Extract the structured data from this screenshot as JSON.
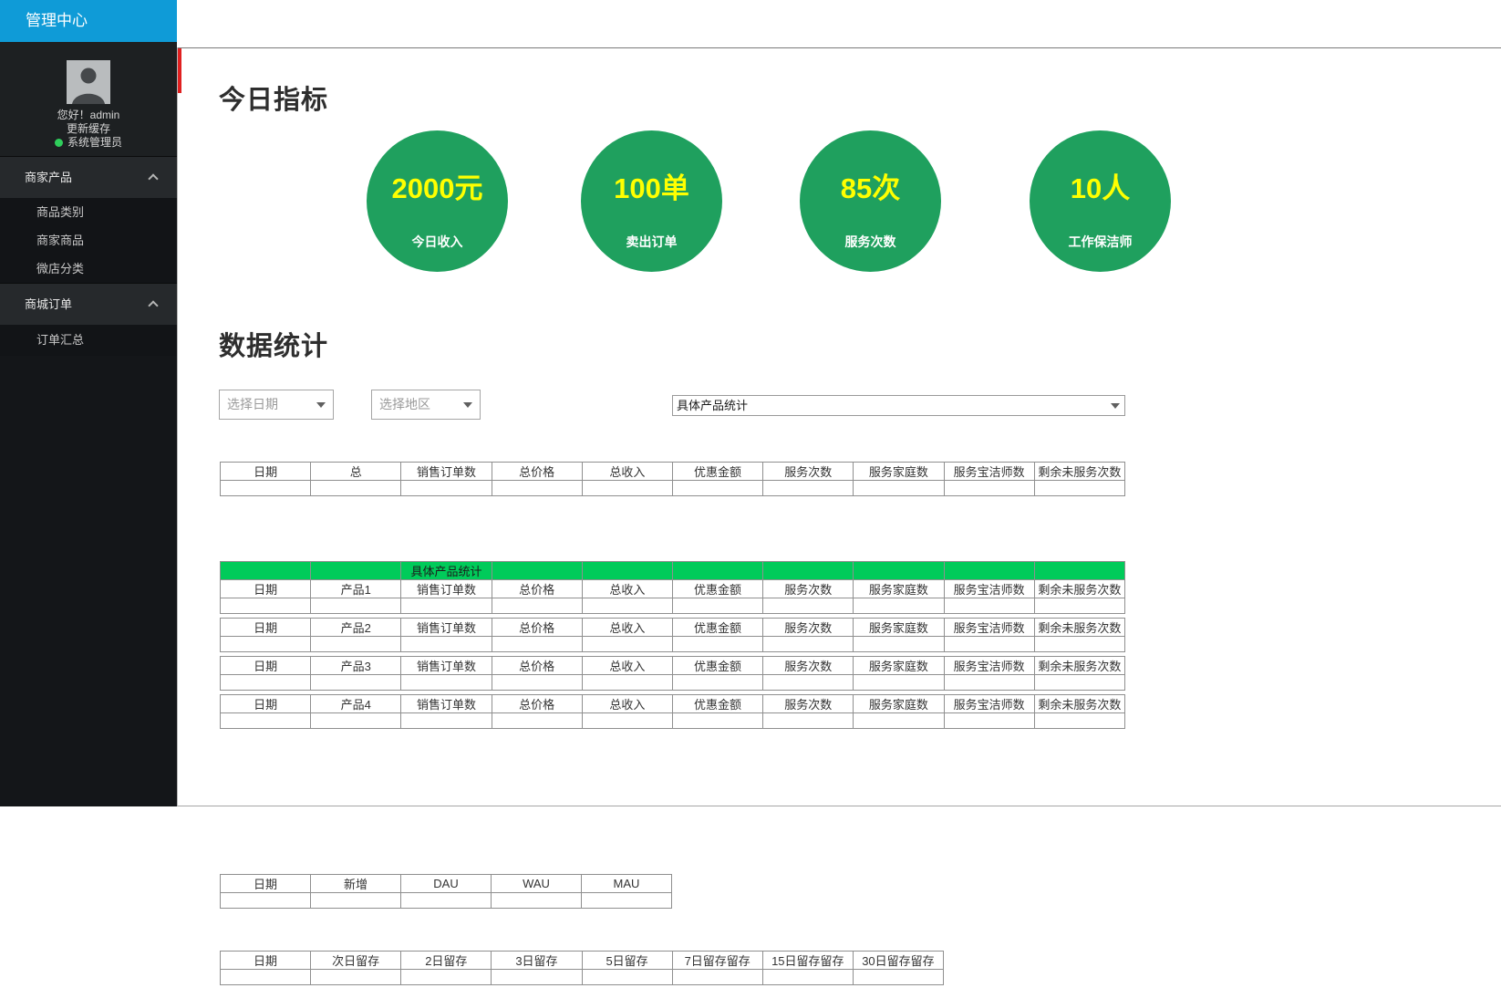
{
  "colors": {
    "accent_blue": "#0f9bd7",
    "metric_circle_green": "#1fa05e",
    "metric_value_yellow": "#ffff00",
    "table_banner_green": "#00cb5a",
    "scroll_indicator_red": "#e02020",
    "online_dot_green": "#2fce5b"
  },
  "app": {
    "title": "管理中心"
  },
  "sidebar": {
    "profile": {
      "greeting": "您好！admin",
      "update_cache": "更新缓存",
      "role": "系统管理员"
    },
    "menus": [
      {
        "label": "商家产品",
        "items": [
          "商品类别",
          "商家商品",
          "微店分类"
        ]
      },
      {
        "label": "商城订单",
        "items": [
          "订单汇总"
        ]
      }
    ]
  },
  "today": {
    "title": "今日指标",
    "metrics": [
      {
        "value": "2000元",
        "label": "今日收入"
      },
      {
        "value": "100单",
        "label": "卖出订单"
      },
      {
        "value": "85次",
        "label": "服务次数"
      },
      {
        "value": "10人",
        "label": "工作保洁师"
      }
    ]
  },
  "stats": {
    "title": "数据统计",
    "date_placeholder": "选择日期",
    "region_placeholder": "选择地区",
    "product_select_value": "具体产品统计"
  },
  "tables": {
    "summary": {
      "headers": [
        "日期",
        "总",
        "销售订单数",
        "总价格",
        "总收入",
        "优惠金额",
        "服务次数",
        "服务家庭数",
        "服务宝洁师数",
        "剩余未服务次数"
      ]
    },
    "products": {
      "banner": [
        "",
        "",
        "具体产品统计",
        "",
        "",
        "",
        "",
        "",
        "",
        ""
      ],
      "groups": [
        {
          "headers": [
            "日期",
            "产品1",
            "销售订单数",
            "总价格",
            "总收入",
            "优惠金额",
            "服务次数",
            "服务家庭数",
            "服务宝洁师数",
            "剩余未服务次数"
          ]
        },
        {
          "headers": [
            "日期",
            "产品2",
            "销售订单数",
            "总价格",
            "总收入",
            "优惠金额",
            "服务次数",
            "服务家庭数",
            "服务宝洁师数",
            "剩余未服务次数"
          ]
        },
        {
          "headers": [
            "日期",
            "产品3",
            "销售订单数",
            "总价格",
            "总收入",
            "优惠金额",
            "服务次数",
            "服务家庭数",
            "服务宝洁师数",
            "剩余未服务次数"
          ]
        },
        {
          "headers": [
            "日期",
            "产品4",
            "销售订单数",
            "总价格",
            "总收入",
            "优惠金额",
            "服务次数",
            "服务家庭数",
            "服务宝洁师数",
            "剩余未服务次数"
          ]
        }
      ]
    },
    "user_activity": {
      "headers": [
        "日期",
        "新增",
        "DAU",
        "WAU",
        "MAU"
      ]
    },
    "retention": {
      "headers": [
        "日期",
        "次日留存",
        "2日留存",
        "3日留存",
        "5日留存",
        "7日留存留存",
        "15日留存留存",
        "30日留存留存"
      ]
    }
  }
}
